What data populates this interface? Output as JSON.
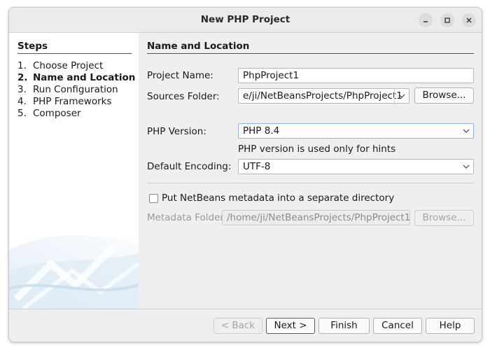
{
  "window": {
    "title": "New PHP Project",
    "controls": [
      "minimize-icon",
      "maximize-icon",
      "close-icon"
    ]
  },
  "steps": {
    "title": "Steps",
    "items": [
      {
        "num": "1.",
        "label": "Choose Project",
        "active": false
      },
      {
        "num": "2.",
        "label": "Name and Location",
        "active": true
      },
      {
        "num": "3.",
        "label": "Run Configuration",
        "active": false
      },
      {
        "num": "4.",
        "label": "PHP Frameworks",
        "active": false
      },
      {
        "num": "5.",
        "label": "Composer",
        "active": false
      }
    ]
  },
  "form": {
    "section_title": "Name and Location",
    "project_name": {
      "label": "Project Name:",
      "value": "PhpProject1"
    },
    "sources_folder": {
      "label": "Sources Folder:",
      "value": "e/ji/NetBeansProjects/PhpProject1",
      "browse_label": "Browse..."
    },
    "php_version": {
      "label": "PHP Version:",
      "value": "PHP 8.4",
      "hint": "PHP version is used only for hints"
    },
    "default_encoding": {
      "label": "Default Encoding:",
      "value": "UTF-8"
    },
    "metadata_checkbox": {
      "label": "Put NetBeans metadata into a separate directory",
      "checked": false
    },
    "metadata_folder": {
      "label": "Metadata Folder:",
      "value": "/home/ji/NetBeansProjects/PhpProject1",
      "browse_label": "Browse..."
    }
  },
  "footer": {
    "back_label": "< Back",
    "next_label": "Next >",
    "finish_label": "Finish",
    "cancel_label": "Cancel",
    "help_label": "Help"
  }
}
